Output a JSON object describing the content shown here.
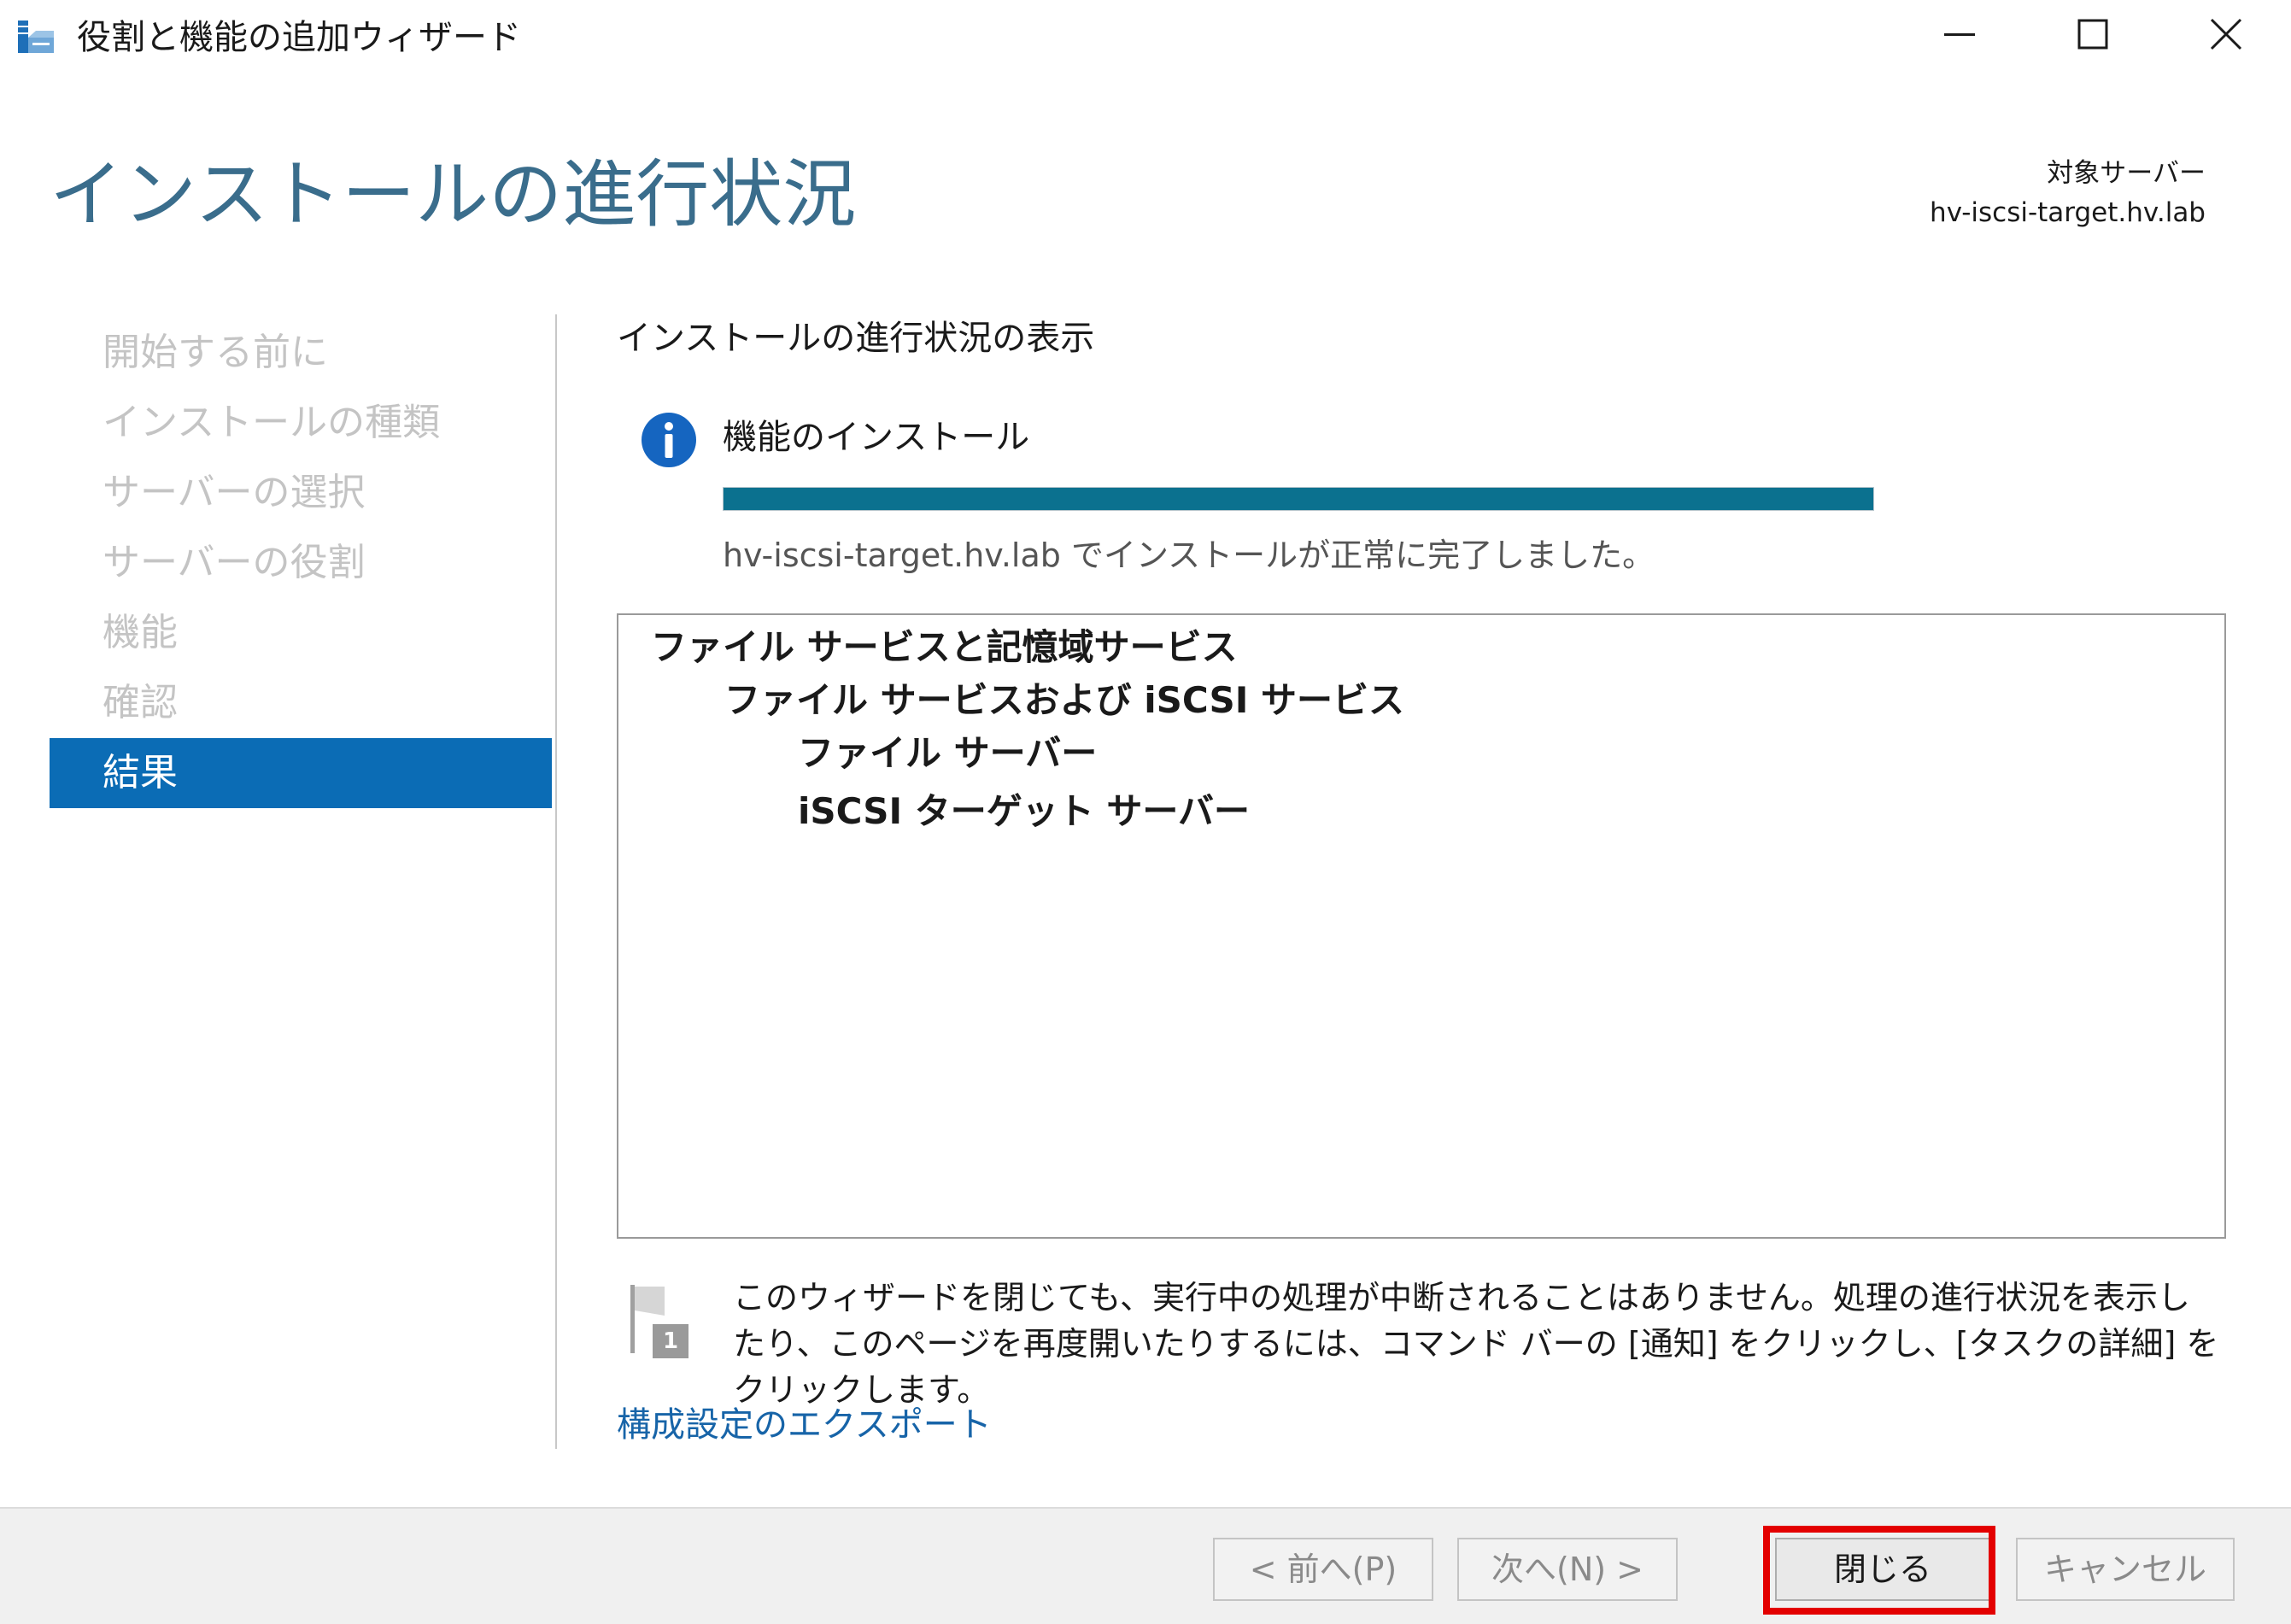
{
  "window": {
    "title": "役割と機能の追加ウィザード",
    "app_icon": "server-manager-wizard-icon",
    "minimize_icon": "minimize-icon",
    "maximize_icon": "maximize-icon",
    "close_icon": "close-icon"
  },
  "header": {
    "page_title": "インストールの進行状況",
    "target_label": "対象サーバー",
    "target_server": "hv-iscsi-target.hv.lab"
  },
  "nav": {
    "items": [
      {
        "label": "開始する前に",
        "active": false
      },
      {
        "label": "インストールの種類",
        "active": false
      },
      {
        "label": "サーバーの選択",
        "active": false
      },
      {
        "label": "サーバーの役割",
        "active": false
      },
      {
        "label": "機能",
        "active": false
      },
      {
        "label": "確認",
        "active": false
      },
      {
        "label": "結果",
        "active": true
      }
    ],
    "active_color": "#0b6cb5",
    "inactive_color": "#c4c4c4"
  },
  "content": {
    "section_title": "インストールの進行状況の表示",
    "info_icon": "info-icon",
    "progress_label": "機能のインストール",
    "progress_value": 1.0,
    "progress_color": "#0b718f",
    "status_text": "hv-iscsi-target.hv.lab でインストールが正常に完了しました。",
    "results_tree": [
      {
        "label": "ファイル サービスと記憶域サービス",
        "level": 0
      },
      {
        "label": "ファイル サービスおよび iSCSI サービス",
        "level": 1
      },
      {
        "label": "ファイル サーバー",
        "level": 2
      },
      {
        "label": "iSCSI ターゲット サーバー",
        "level": 2
      }
    ],
    "note_icon": "notification-flag-icon",
    "note_badge": "1",
    "note_text": "このウィザードを閉じても、実行中の処理が中断されることはありません。処理の進行状況を表示したり、このページを再度開いたりするには、コマンド バーの [通知] をクリックし、[タスクの詳細] をクリックします。",
    "export_link": "構成設定のエクスポート"
  },
  "footer": {
    "prev_label": "< 前へ(P)",
    "next_label": "次へ(N) >",
    "close_label": "閉じる",
    "cancel_label": "キャンセル",
    "highlight_color": "#e30000"
  }
}
